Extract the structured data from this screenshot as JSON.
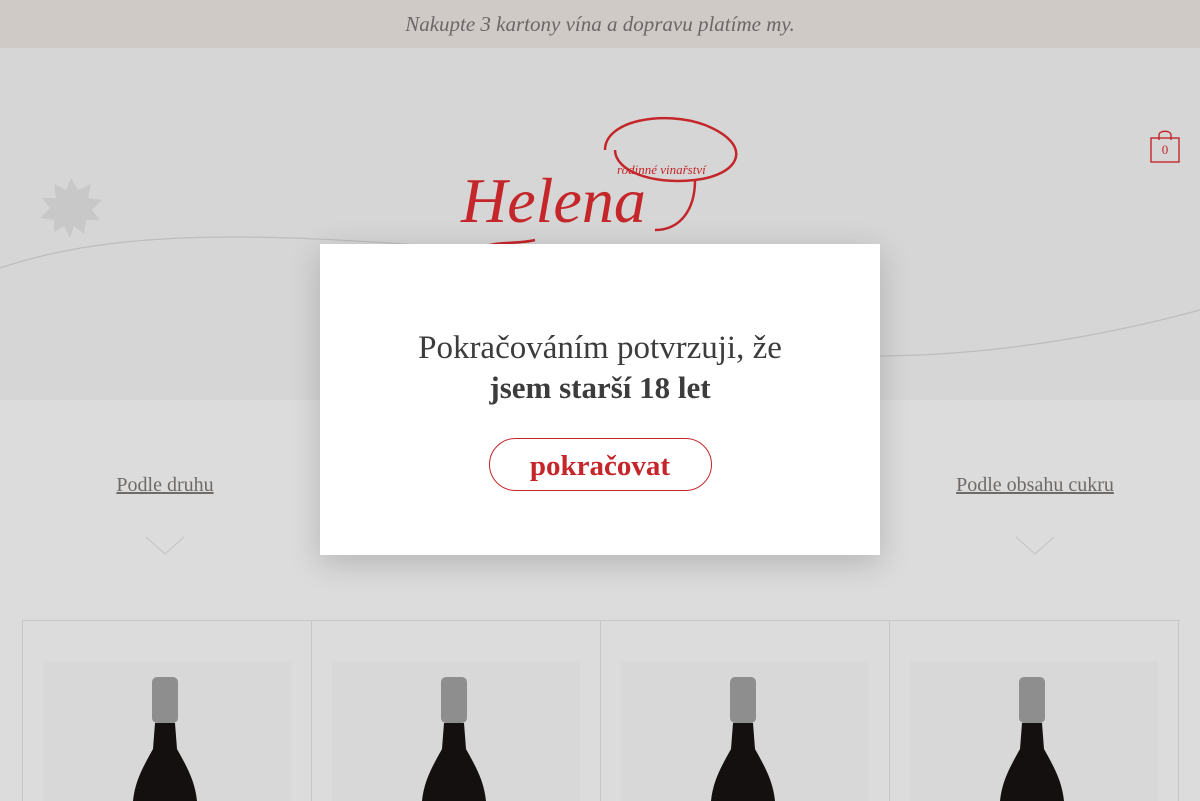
{
  "promo_bar": {
    "text": "Nakupte 3 kartony vína a dopravu platíme my."
  },
  "logo": {
    "name": "Helena",
    "tagline": "rodinné vinařství"
  },
  "cart": {
    "count": "0"
  },
  "filters": [
    {
      "label": "Podle druhu"
    },
    {
      "label": "Podle obsahu cukru"
    }
  ],
  "age_modal": {
    "line1": "Pokračováním potvrzuji, že",
    "line2": "jsem starší 18 let",
    "button_label": "pokračovat"
  },
  "colors": {
    "accent": "#c4262a",
    "promo_bg": "#cfcac6",
    "page_bg": "#dcdcdc"
  }
}
